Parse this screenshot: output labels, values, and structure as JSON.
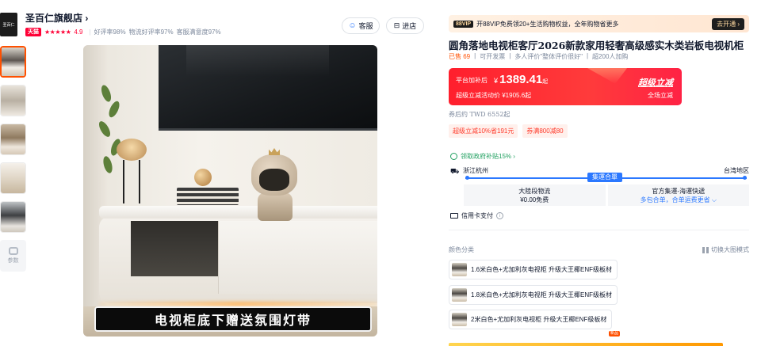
{
  "shop": {
    "logo_text": "圣百仁",
    "name": "圣百仁旗舰店 ›",
    "badge": "天猫",
    "stars": "★★★★★",
    "score": "4.9",
    "ratings": [
      "好评率98%",
      "物流好评率97%",
      "客服满意度97%"
    ],
    "service_button": "客服",
    "enter_shop_button": "进店"
  },
  "thumbnails": {
    "params_label": "参数"
  },
  "main_image": {
    "caption": "电视柜底下赠送氛围灯带"
  },
  "vip": {
    "tag": "88VIP",
    "text": "开88VIP免费领20+生活购物权益，全年购物省更多",
    "button": "去开通 ›"
  },
  "product": {
    "title": "圆角落地电视柜客厅2026新款家用轻奢高级感实木类岩板电视机柜",
    "sold": "已售 69",
    "delivery": "可开发票",
    "reviews": "多人评价\"整体评价很好\"",
    "cart_count": "超200人加购"
  },
  "price": {
    "label": "平台加补后",
    "currency": "¥",
    "value": "1389.41",
    "suffix": "起",
    "sub": "超级立减活动价 ¥1905.6起",
    "promo_title": "超级立减",
    "promo_sub": "全场立减"
  },
  "after_coupon": "券后约 TWD 6552起",
  "coupons": [
    "超级立减10%省191元",
    "券满800减80"
  ],
  "gov_subsidy": "领取政府补贴15% ›",
  "shipping": {
    "from": "浙江杭州",
    "to": "台湾地区",
    "route_tag": "集運合單",
    "cells": [
      {
        "line1": "大陸段物流",
        "line2": "¥0.00免费"
      },
      {
        "line1": "官方集運-海運快遞",
        "line2": "多包合单，合单运费更省 ⌵"
      }
    ]
  },
  "payment": {
    "label": "信用卡支付",
    "info_icon": "i"
  },
  "options": {
    "label": "颜色分类",
    "big_mode": "切换大图模式",
    "items": [
      "1.6米白色+尤加利灰电视柜 升级大王椰ENF级板材",
      "1.8米白色+尤加利灰电视柜 升级大王椰ENF级板材",
      "2米白色+尤加利灰电视柜 升级大王椰ENF级板材"
    ],
    "new_badge": "新品"
  }
}
